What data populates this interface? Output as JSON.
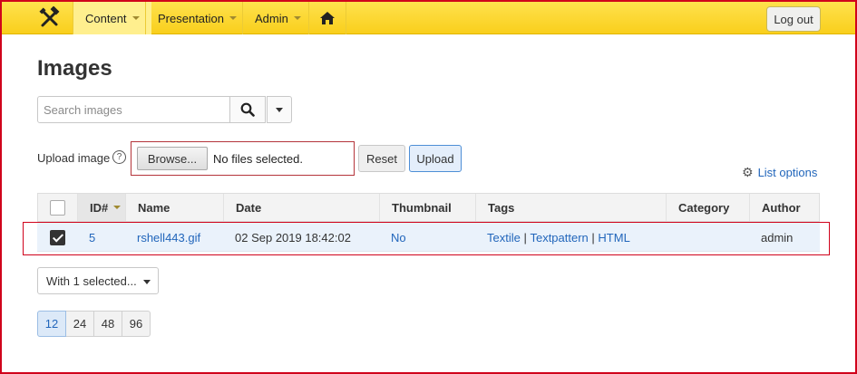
{
  "nav": {
    "items": [
      {
        "label": "Content"
      },
      {
        "label": "Presentation"
      },
      {
        "label": "Admin"
      }
    ],
    "logout_label": "Log out"
  },
  "page": {
    "title": "Images"
  },
  "search": {
    "placeholder": "Search images",
    "value": ""
  },
  "upload": {
    "label": "Upload image",
    "help": "?",
    "browse_label": "Browse...",
    "file_status": "No files selected.",
    "reset_label": "Reset",
    "upload_label": "Upload"
  },
  "list_options_label": "List options",
  "table": {
    "columns": [
      "ID#",
      "Name",
      "Date",
      "Thumbnail",
      "Tags",
      "Category",
      "Author"
    ],
    "rows": [
      {
        "checked": true,
        "id": "5",
        "name": "rshell443.gif",
        "date": "02 Sep 2019 18:42:02",
        "thumbnail": "No",
        "tags": [
          "Textile",
          "Textpattern",
          "HTML"
        ],
        "tag_separator": " | ",
        "category": "",
        "author": "admin"
      }
    ]
  },
  "bulk_action": {
    "label": "With 1 selected..."
  },
  "pager": {
    "sizes": [
      "12",
      "24",
      "48",
      "96"
    ],
    "active": "12"
  },
  "colors": {
    "accent": "#2266bb",
    "nav_bg": "#f9cf1c",
    "highlight_outline": "#d0021b"
  }
}
